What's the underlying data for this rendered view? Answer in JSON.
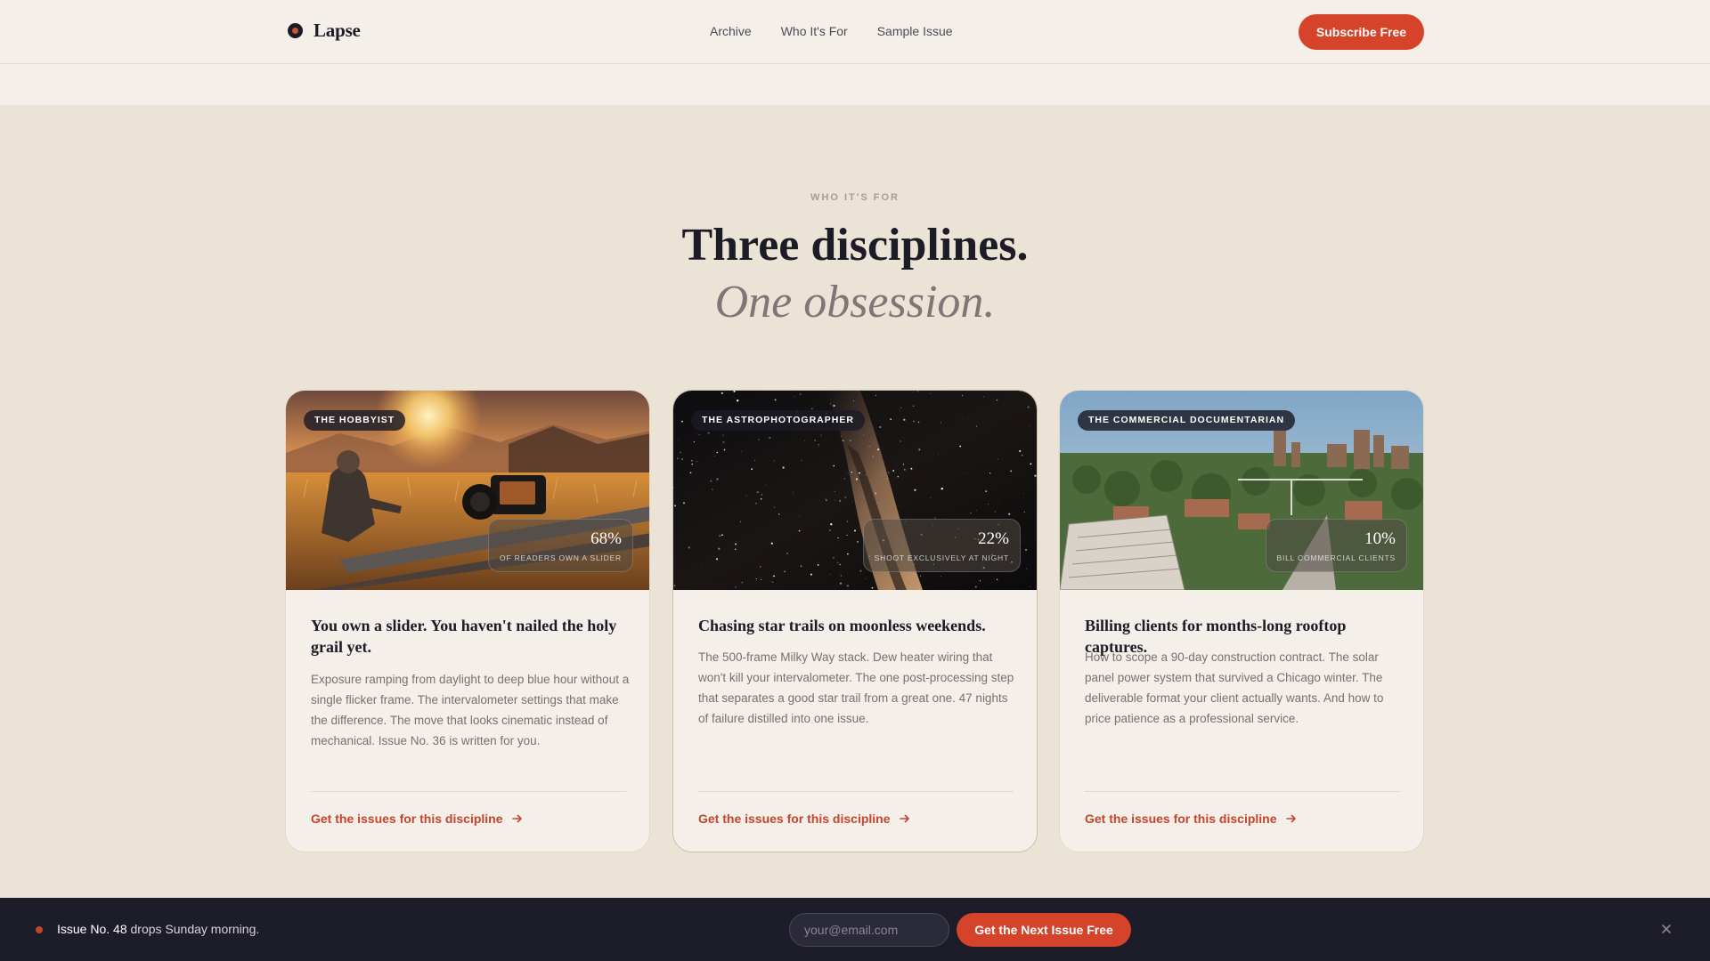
{
  "nav": {
    "brand": "Lapse",
    "links": [
      "Archive",
      "Who It's For",
      "Sample Issue"
    ],
    "cta": "Subscribe Free"
  },
  "section": {
    "eyebrow": "WHO IT'S FOR",
    "headline": "Three disciplines.",
    "headline_italic": "One obsession."
  },
  "cards": [
    {
      "tag": "THE HOBBYIST",
      "stat_value": "68%",
      "stat_label": "OF READERS OWN A SLIDER",
      "title": "You own a slider. You haven't nailed the holy grail yet.",
      "body": "Exposure ramping from daylight to deep blue hour without a single flicker frame. The intervalometer settings that make the difference. The move that looks cinematic instead of mechanical. Issue No. 36 is written for you.",
      "link": "Get the issues for this discipline"
    },
    {
      "tag": "THE ASTROPHOTOGRAPHER",
      "stat_value": "22%",
      "stat_label": "SHOOT EXCLUSIVELY AT NIGHT",
      "title": "Chasing star trails on moonless weekends.",
      "body": "The 500-frame Milky Way stack. Dew heater wiring that won't kill your intervalometer. The one post-processing step that separates a good star trail from a great one. 47 nights of failure distilled into one issue.",
      "link": "Get the issues for this discipline"
    },
    {
      "tag": "THE COMMERCIAL DOCUMENTARIAN",
      "stat_value": "10%",
      "stat_label": "BILL COMMERCIAL CLIENTS",
      "title": "Billing clients for months-long rooftop captures.",
      "body": "How to scope a 90-day construction contract. The solar panel power system that survived a Chicago winter. The deliverable format your client actually wants. And how to price patience as a professional service.",
      "link": "Get the issues for this discipline"
    }
  ],
  "bottom_bar": {
    "issue": "Issue No. 48",
    "text": " drops Sunday morning.",
    "email_placeholder": "your@email.com",
    "cta": "Get the Next Issue Free"
  },
  "icons": {
    "brand": "aperture-logo-icon",
    "arrow": "arrow-right-icon",
    "close": "close-icon"
  },
  "colors": {
    "accent": "#d6432b",
    "background": "#ece3d7",
    "dark_bar": "#1d1c29"
  }
}
